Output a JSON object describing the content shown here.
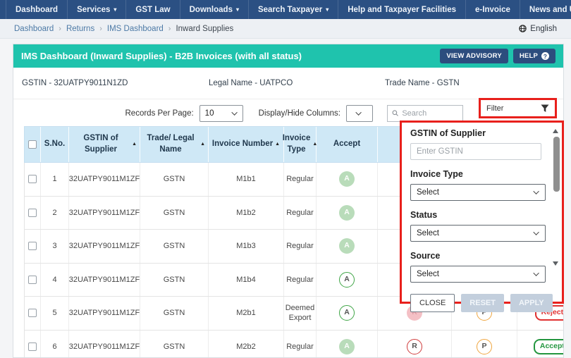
{
  "nav": {
    "items": [
      {
        "label": "Dashboard",
        "caret": false
      },
      {
        "label": "Services",
        "caret": true
      },
      {
        "label": "GST Law",
        "caret": false
      },
      {
        "label": "Downloads",
        "caret": true
      },
      {
        "label": "Search Taxpayer",
        "caret": true
      },
      {
        "label": "Help and Taxpayer Facilities",
        "caret": false
      },
      {
        "label": "e-Invoice",
        "caret": false
      },
      {
        "label": "News and Updates",
        "caret": false
      }
    ]
  },
  "breadcrumb": {
    "links": [
      "Dashboard",
      "Returns",
      "IMS Dashboard"
    ],
    "current": "Inward Supplies",
    "language": "English"
  },
  "header": {
    "title": "IMS Dashboard (Inward Supplies) - B2B Invoices (with all status)",
    "advisory_button": "VIEW ADVISORY",
    "help_button": "HELP",
    "help_icon": "?"
  },
  "info": {
    "gstin": "GSTIN - 32UATPY9011N1ZD",
    "legal_name": "Legal Name - UATPCO",
    "trade_name": "Trade Name - GSTN"
  },
  "controls": {
    "records_label": "Records Per Page:",
    "records_value": "10",
    "columns_label": "Display/Hide Columns:",
    "search_placeholder": "Search",
    "filter_label": "Filter"
  },
  "table": {
    "headers": [
      {
        "label": "S.No.",
        "sort": false
      },
      {
        "label": "GSTIN of Supplier",
        "sort": true
      },
      {
        "label": "Trade/ Legal Name",
        "sort": true
      },
      {
        "label": "Invoice Number",
        "sort": true
      },
      {
        "label": "Invoice Type",
        "sort": true
      },
      {
        "label": "Accept",
        "sort": false
      }
    ],
    "sort_arrow": "▲",
    "rows": [
      {
        "sno": "1",
        "gstin": "32UATPY9011M1ZF",
        "trade_name": "GSTN",
        "invoice_number": "M1b1",
        "invoice_type": "Regular",
        "accept": {
          "letter": "A",
          "state": "filled-green"
        },
        "reject": null,
        "pending": null,
        "status": null
      },
      {
        "sno": "2",
        "gstin": "32UATPY9011M1ZF",
        "trade_name": "GSTN",
        "invoice_number": "M1b2",
        "invoice_type": "Regular",
        "accept": {
          "letter": "A",
          "state": "filled-green"
        },
        "reject": null,
        "pending": null,
        "status": null
      },
      {
        "sno": "3",
        "gstin": "32UATPY9011M1ZF",
        "trade_name": "GSTN",
        "invoice_number": "M1b3",
        "invoice_type": "Regular",
        "accept": {
          "letter": "A",
          "state": "filled-green"
        },
        "reject": null,
        "pending": null,
        "status": null
      },
      {
        "sno": "4",
        "gstin": "32UATPY9011M1ZF",
        "trade_name": "GSTN",
        "invoice_number": "M1b4",
        "invoice_type": "Regular",
        "accept": {
          "letter": "A",
          "state": "outline-green"
        },
        "reject": null,
        "pending": null,
        "status": null
      },
      {
        "sno": "5",
        "gstin": "32UATPY9011M1ZF",
        "trade_name": "GSTN",
        "invoice_number": "M2b1",
        "invoice_type": "Deemed Export",
        "accept": {
          "letter": "A",
          "state": "outline-green"
        },
        "reject": {
          "letter": "R",
          "state": "filled-pink"
        },
        "pending": {
          "letter": "P",
          "state": "outline-orange"
        },
        "status": {
          "label": "Rejected",
          "state": "rejected"
        }
      },
      {
        "sno": "6",
        "gstin": "32UATPY9011M1ZF",
        "trade_name": "GSTN",
        "invoice_number": "M2b2",
        "invoice_type": "Regular",
        "accept": {
          "letter": "A",
          "state": "filled-green"
        },
        "reject": {
          "letter": "R",
          "state": "outline-red"
        },
        "pending": {
          "letter": "P",
          "state": "outline-orange"
        },
        "status": {
          "label": "Accepted",
          "state": "accepted"
        }
      }
    ]
  },
  "filter_panel": {
    "gstin_label": "GSTIN of Supplier",
    "gstin_placeholder": "Enter GSTIN",
    "fields": [
      {
        "label": "Invoice Type",
        "value": "Select"
      },
      {
        "label": "Status",
        "value": "Select"
      },
      {
        "label": "Source",
        "value": "Select"
      }
    ],
    "buttons": {
      "close": "CLOSE",
      "reset": "RESET",
      "apply": "APPLY"
    }
  },
  "colors": {
    "navbar_blue": "#2b5083",
    "header_teal": "#1fc3ad",
    "button_navy": "#2c4d7e",
    "table_header_blue": "#cfe8f6",
    "annotation_red": "#e8201c",
    "accept_green": "#3fa546",
    "accept_fill": "#b9dcba",
    "reject_red": "#cf3b3b",
    "reject_fill": "#f4c0c5",
    "pending_orange": "#efa53e",
    "rejected_text": "#e03131",
    "accepted_text": "#23963f"
  }
}
